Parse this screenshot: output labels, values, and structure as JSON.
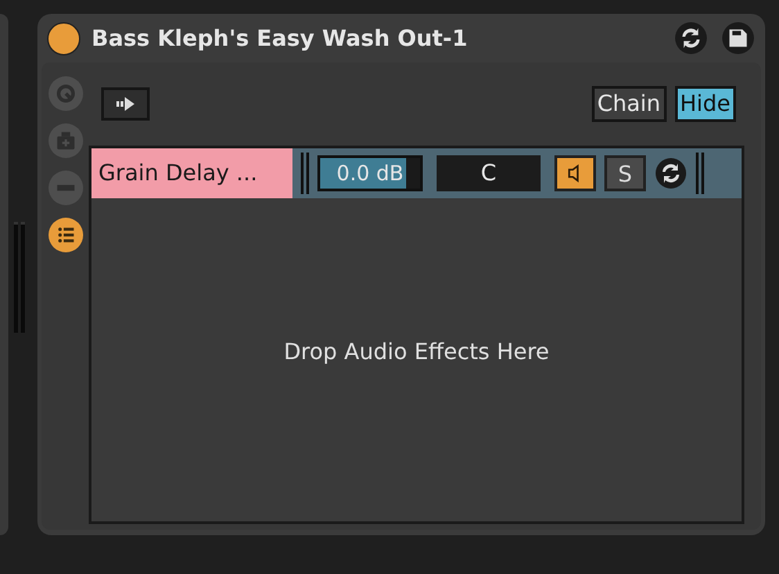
{
  "device": {
    "title": "Bass Kleph's Easy Wash Out-1",
    "on": true
  },
  "side_buttons": [
    {
      "kind": "macro",
      "selected": false
    },
    {
      "kind": "random",
      "selected": false
    },
    {
      "kind": "variation",
      "selected": false
    },
    {
      "kind": "chain_list",
      "selected": true
    }
  ],
  "view_buttons": [
    {
      "label": "Chain",
      "selected": false
    },
    {
      "label": "Hide",
      "selected": true
    }
  ],
  "chains": [
    {
      "name": "Grain Delay ...",
      "volume": "0.0 dB",
      "level": 0.86,
      "pan": "C",
      "active": true,
      "solo": "S",
      "soloed": false
    }
  ],
  "drop_hint": "Drop Audio Effects Here"
}
